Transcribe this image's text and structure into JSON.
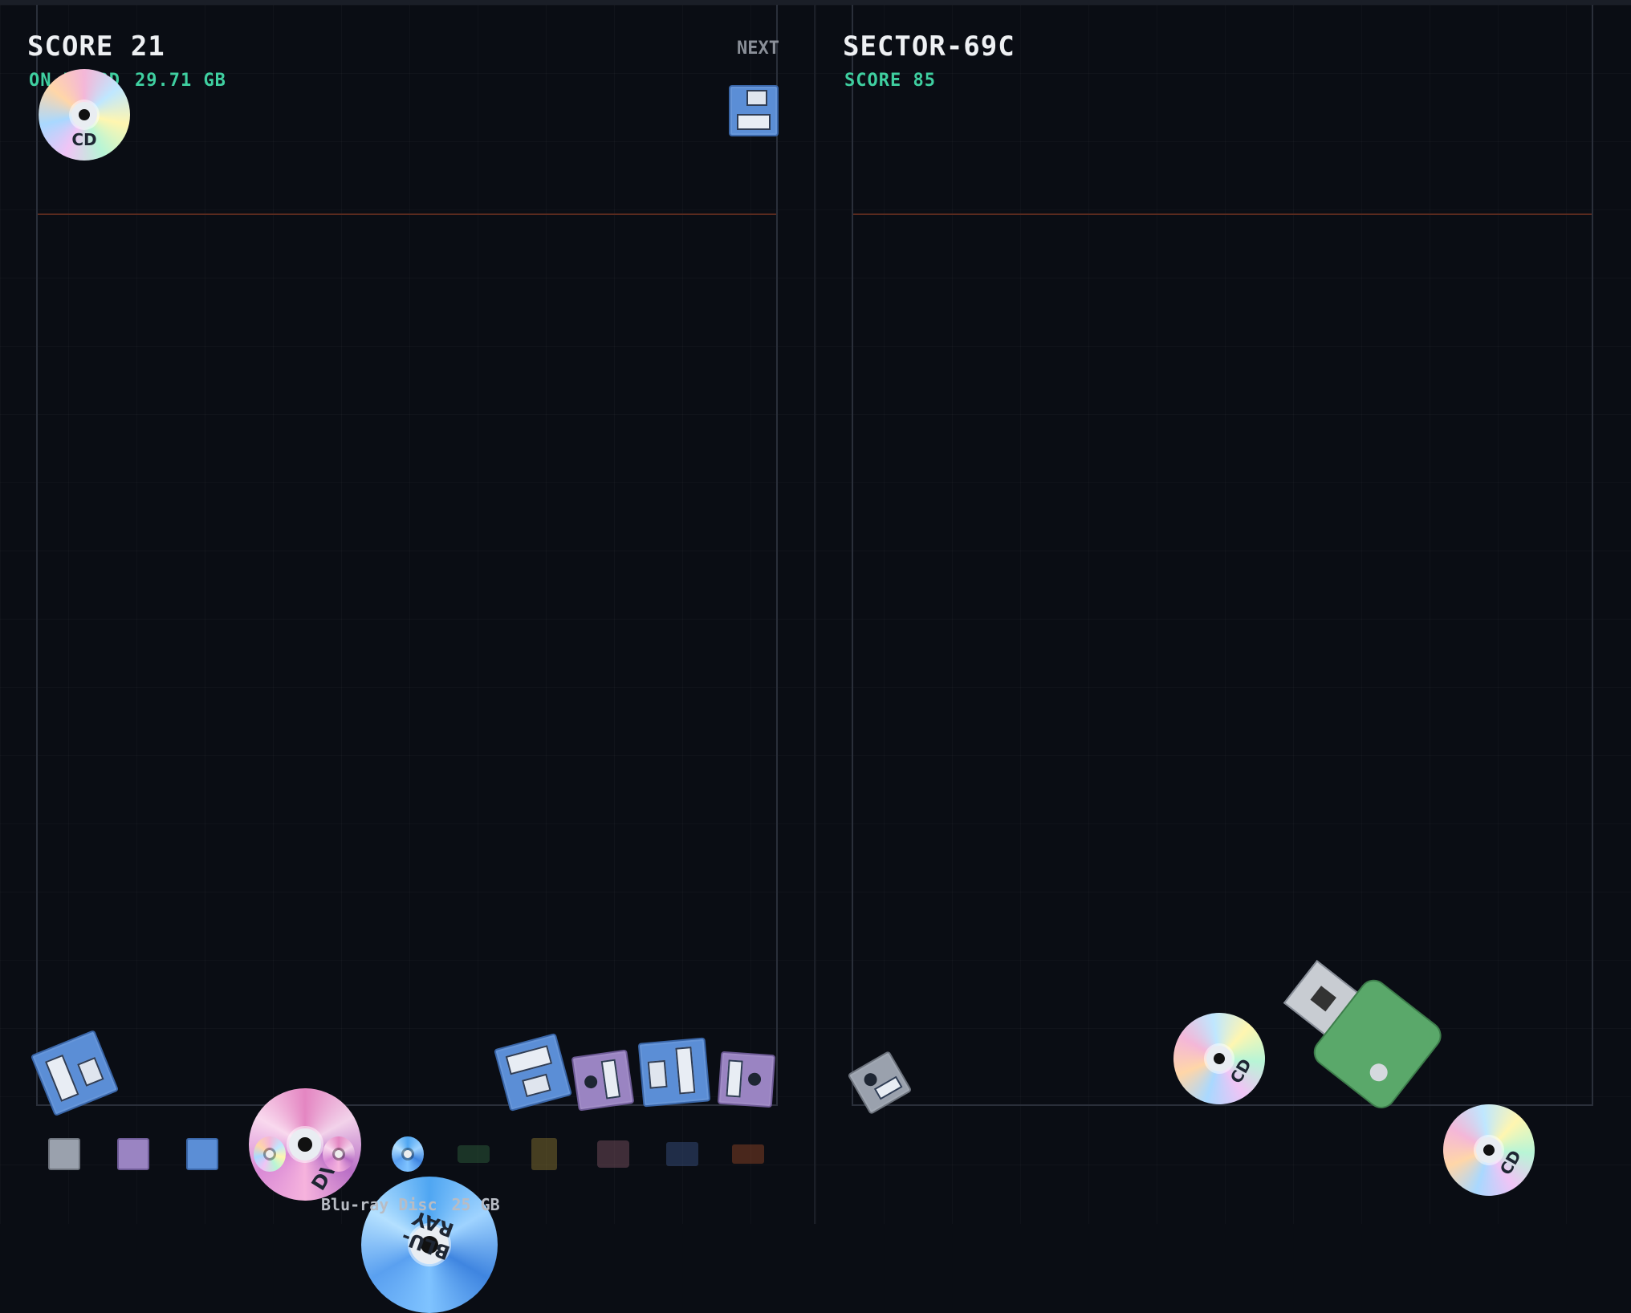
{
  "player": {
    "score_label": "SCORE 21",
    "onboard_label": "ON BOARD",
    "onboard_value": "29.71 GB",
    "next_label": "NEXT"
  },
  "opponent": {
    "name": "SECTOR-69C",
    "score_label": "SCORE 85"
  },
  "pieces": {
    "cd": "CD",
    "dvd": "DVD",
    "bluray": "BLU-RAY"
  },
  "tray": {
    "items": [
      "floppy-gray",
      "floppy-purple",
      "floppy-blue",
      "cd",
      "dvd",
      "bluray",
      "usb-drive",
      "sd-card",
      "hard-drive",
      "ssd",
      "tape"
    ],
    "unlocked_count": 6
  },
  "selected": {
    "name": "Blu-ray Disc",
    "capacity": "25 GB"
  },
  "colors": {
    "accent_green": "#3fcfa0",
    "danger_line": "#5a2a1e",
    "floppy_blue": "#5b8ed6",
    "floppy_purple": "#9a84c2",
    "usb_green": "#5aa86a"
  }
}
